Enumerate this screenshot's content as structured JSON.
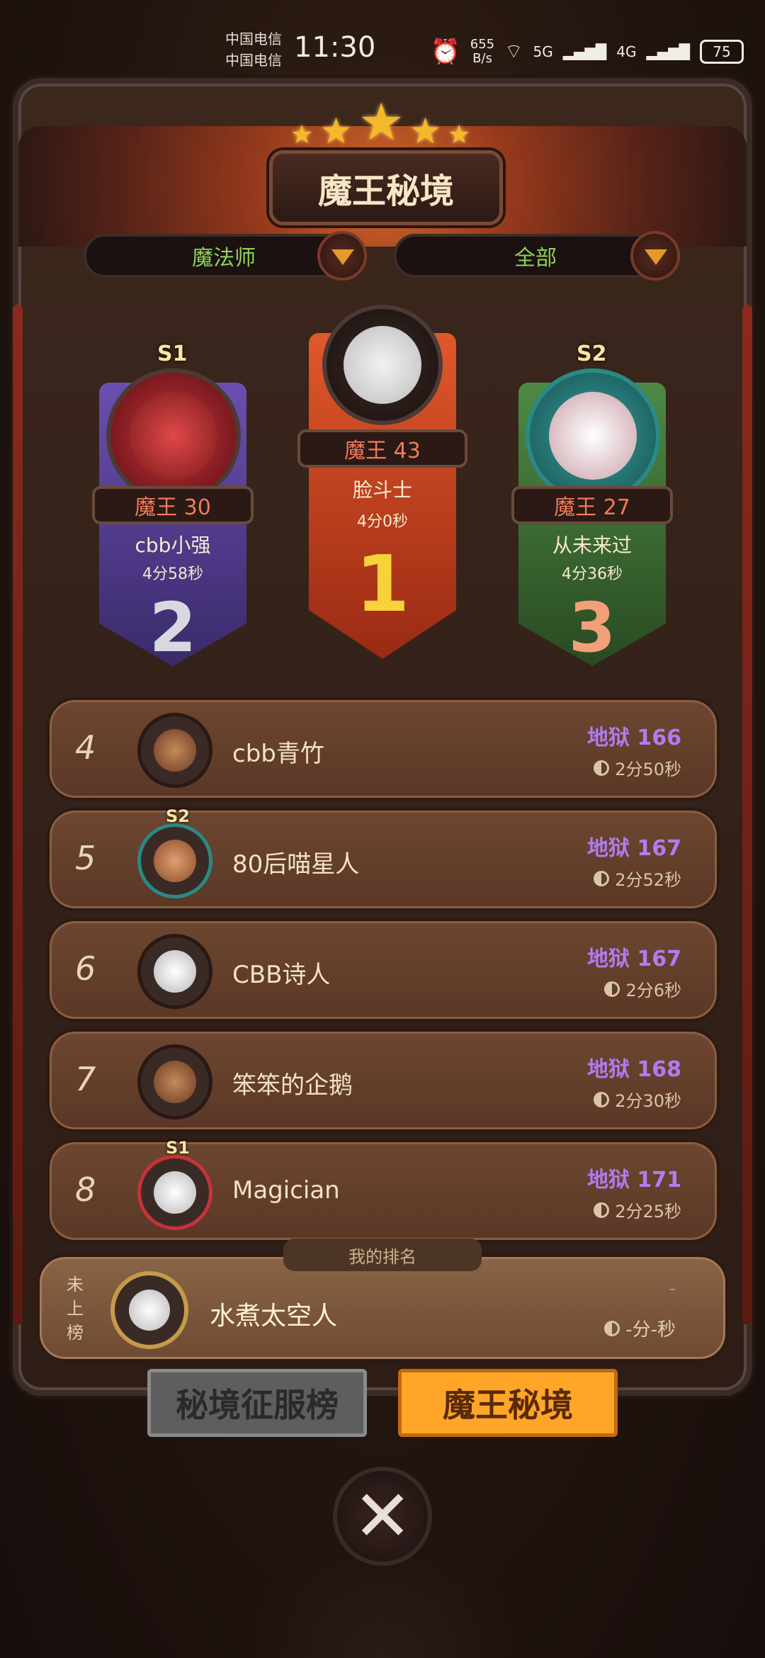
{
  "status": {
    "carrier1": "中国电信",
    "carrier2": "中国电信",
    "time": "11:30",
    "netspeed_value": "655",
    "netspeed_unit": "B/s",
    "signal_a": "5G",
    "signal_b": "4G",
    "battery": "75"
  },
  "header": {
    "title": "魔王秘境"
  },
  "filters": {
    "class": "魔法师",
    "scope": "全部"
  },
  "podium": [
    {
      "place": "2",
      "season": "S1",
      "rank_label": "魔王 30",
      "name": "cbb小强",
      "time": "4分58秒",
      "color": "#5a3f9a"
    },
    {
      "place": "1",
      "season": "",
      "rank_label": "魔王 43",
      "name": "脸斗士",
      "time": "4分0秒",
      "color": "#c4421e"
    },
    {
      "place": "3",
      "season": "S2",
      "rank_label": "魔王 27",
      "name": "从未来过",
      "time": "4分36秒",
      "color": "#3f7a3a"
    }
  ],
  "rows": [
    {
      "num": "4",
      "name": "cbb青竹",
      "level": "地狱 166",
      "time": "2分50秒"
    },
    {
      "num": "5",
      "name": "80后喵星人",
      "level": "地狱 167",
      "time": "2分52秒",
      "season": "S2"
    },
    {
      "num": "6",
      "name": "CBB诗人",
      "level": "地狱 167",
      "time": "2分6秒"
    },
    {
      "num": "7",
      "name": "笨笨的企鹅",
      "level": "地狱 168",
      "time": "2分30秒"
    },
    {
      "num": "8",
      "name": "Magician",
      "level": "地狱 171",
      "time": "2分25秒",
      "season": "S1"
    }
  ],
  "my_rank": {
    "label": "我的排名",
    "status": "未上榜",
    "name": "水煮太空人",
    "level": "-",
    "time": "-分-秒"
  },
  "tabs": {
    "conquest": "秘境征服榜",
    "demon": "魔王秘境"
  },
  "colors": {
    "accent": "#ffa629",
    "level_purple": "#b07cf0",
    "filter_green": "#8fd25a"
  }
}
